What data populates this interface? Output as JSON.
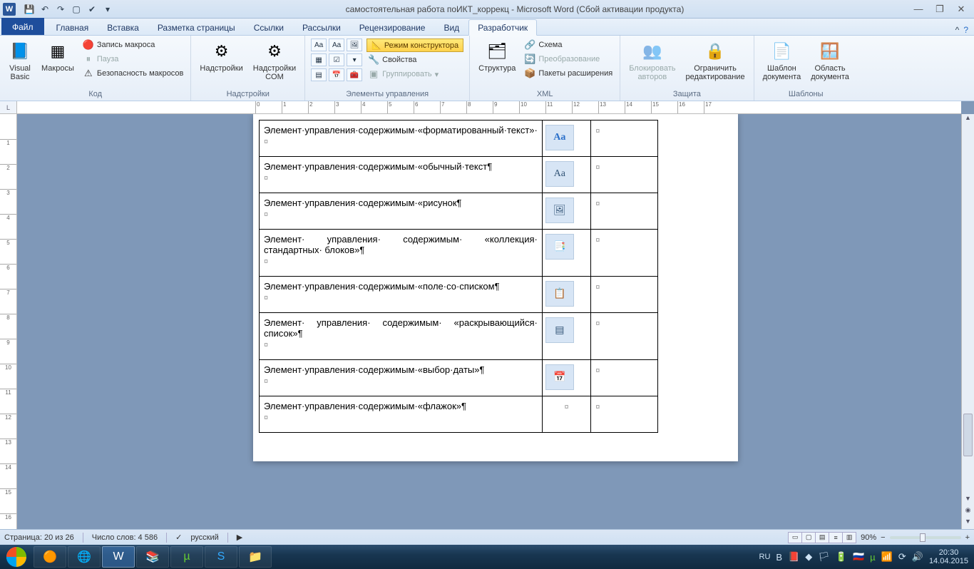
{
  "titlebar": {
    "app_title": "самостоятельная работа поИКТ_коррекц - Microsoft Word (Сбой активации продукта)"
  },
  "tabs": {
    "file": "Файл",
    "items": [
      "Главная",
      "Вставка",
      "Разметка страницы",
      "Ссылки",
      "Рассылки",
      "Рецензирование",
      "Вид",
      "Разработчик"
    ],
    "active_index": 7
  },
  "ribbon": {
    "code": {
      "visual_basic": "Visual\nBasic",
      "macros": "Макросы",
      "record": "Запись макроса",
      "pause": "Пауза",
      "security": "Безопасность макросов",
      "label": "Код"
    },
    "addins": {
      "addins": "Надстройки",
      "com": "Надстройки\nCOM",
      "label": "Надстройки"
    },
    "controls": {
      "design_mode": "Режим конструктора",
      "properties": "Свойства",
      "group": "Группировать",
      "label": "Элементы управления"
    },
    "xml": {
      "structure": "Структура",
      "schema": "Схема",
      "transform": "Преобразование",
      "expansion": "Пакеты расширения",
      "label": "XML"
    },
    "protect": {
      "block": "Блокировать\nавторов",
      "restrict": "Ограничить\nредактирование",
      "label": "Защита"
    },
    "templates": {
      "doc_template": "Шаблон\nдокумента",
      "doc_panel": "Область\nдокумента",
      "label": "Шаблоны"
    }
  },
  "ruler_corner": "L",
  "document_rows": [
    {
      "text": "Элемент·управления·содержимым·«форматированный·текст»·",
      "icon": "Aa",
      "icon_style": "bold"
    },
    {
      "text": "Элемент·управления·содержимым·«обычный·текст¶",
      "icon": "Aa",
      "icon_style": "plain"
    },
    {
      "text": "Элемент·управления·содержимым·«рисунок¶",
      "icon": "🖼"
    },
    {
      "text": "Элемент· управления· содержимым· «коллекция· стандартных· блоков»¶",
      "icon": "📑"
    },
    {
      "text": "Элемент·управления·содержимым·«поле·со·списком¶",
      "icon": "📋"
    },
    {
      "text": "Элемент· управления· содержимым· «раскрывающийся· список»¶",
      "icon": "▤"
    },
    {
      "text": "Элемент·управления·содержимым·«выбор·даты»¶",
      "icon": "📅"
    },
    {
      "text": "Элемент·управления·содержимым·«флажок»¶",
      "icon": ""
    }
  ],
  "status": {
    "page": "Страница: 20 из 26",
    "words": "Число слов: 4 586",
    "lang": "русский",
    "zoom": "90%"
  },
  "tray": {
    "lang": "RU",
    "time": "20:30",
    "date": "14.04.2015"
  }
}
